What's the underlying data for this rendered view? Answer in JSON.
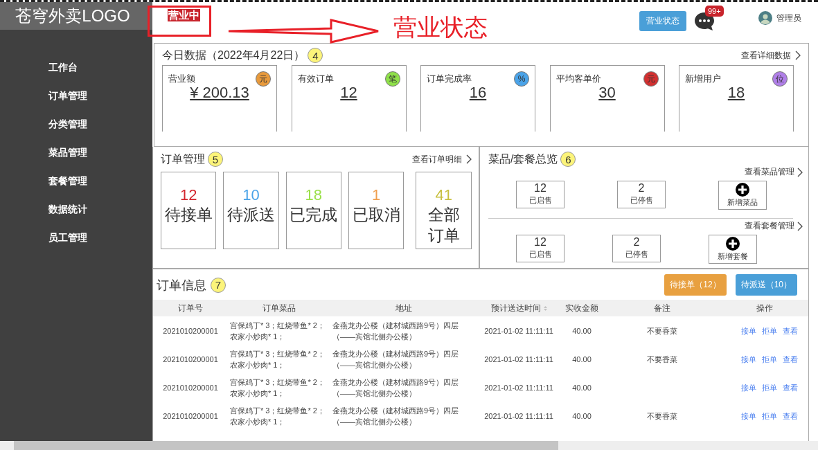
{
  "sidebar": {
    "logo": "苍穹外卖LOGO",
    "items": [
      {
        "label": "工作台"
      },
      {
        "label": "订单管理"
      },
      {
        "label": "分类管理"
      },
      {
        "label": "菜品管理"
      },
      {
        "label": "套餐管理"
      },
      {
        "label": "数据统计"
      },
      {
        "label": "员工管理"
      }
    ]
  },
  "header": {
    "status_badge": "营业中",
    "status_button": "营业状态",
    "message_count": "99+",
    "user": "管理员"
  },
  "annotation": {
    "label": "营业状态"
  },
  "today": {
    "title": "今日数据（2022年4月22日）",
    "marker": "4",
    "link": "查看详细数据",
    "cards": [
      {
        "label": "营业额",
        "value": "¥ 200.13",
        "unit": "元",
        "color": "#e89a3c"
      },
      {
        "label": "有效订单",
        "value": "12",
        "unit": "笔",
        "color": "#8fe04a"
      },
      {
        "label": "订单完成率",
        "value": "16",
        "unit": "%",
        "color": "#4aa3e8"
      },
      {
        "label": "平均客单价",
        "value": "30",
        "unit": "元",
        "color": "#d23030"
      },
      {
        "label": "新增用户",
        "value": "18",
        "unit": "位",
        "color": "#b07fe8"
      }
    ]
  },
  "orders": {
    "title": "订单管理",
    "marker": "5",
    "link": "查看订单明细",
    "tiles": [
      {
        "count": "12",
        "label": "待接单",
        "color": "#d3262e"
      },
      {
        "count": "10",
        "label": "待派送",
        "color": "#4aa3e8"
      },
      {
        "count": "18",
        "label": "已完成",
        "color": "#9be04a"
      },
      {
        "count": "1",
        "label": "已取消",
        "color": "#f0a050"
      },
      {
        "count": "41",
        "label": "全部订单",
        "color": "#c8c040"
      }
    ]
  },
  "overview": {
    "title": "菜品/套餐总览",
    "marker": "6",
    "groups": [
      {
        "link": "查看菜品管理",
        "stats": [
          {
            "count": "12",
            "label": "已启售"
          },
          {
            "count": "2",
            "label": "已停售"
          }
        ],
        "add": "新增菜品"
      },
      {
        "link": "查看套餐管理",
        "stats": [
          {
            "count": "12",
            "label": "已启售"
          },
          {
            "count": "2",
            "label": "已停售"
          }
        ],
        "add": "新增套餐"
      }
    ]
  },
  "order_info": {
    "title": "订单信息",
    "marker": "7",
    "buttons": [
      {
        "label": "待接单（12）",
        "color": "#e8a040"
      },
      {
        "label": "待派送（10）",
        "color": "#4a9fd8"
      }
    ]
  },
  "table": {
    "columns": [
      "订单号",
      "订单菜品",
      "地址",
      "预计送达时间",
      "实收金额",
      "备注",
      "操作"
    ],
    "rows": [
      {
        "order_no": "2021010200001",
        "dishes": "宫保鸡丁* 3；红烧带鱼* 2；农家小炒肉* 1；",
        "address": "金燕龙办公楼（建材城西路9号）四层（——宾馆北侧办公楼）",
        "eta": "2021-01-02 11:11:11",
        "amount": "40.00",
        "note": "不要香菜",
        "actions": [
          "接单",
          "拒单",
          "查看"
        ]
      },
      {
        "order_no": "2021010200001",
        "dishes": "宫保鸡丁* 3；红烧带鱼* 2；农家小炒肉* 1；",
        "address": "金燕龙办公楼（建材城西路9号）四层（——宾馆北侧办公楼）",
        "eta": "2021-01-02 11:11:11",
        "amount": "40.00",
        "note": "不要香菜",
        "actions": [
          "接单",
          "拒单",
          "查看"
        ]
      },
      {
        "order_no": "2021010200001",
        "dishes": "宫保鸡丁* 3；红烧带鱼* 2；农家小炒肉* 1；",
        "address": "金燕龙办公楼（建材城西路9号）四层（——宾馆北侧办公楼）",
        "eta": "2021-01-02 11:11:11",
        "amount": "40.00",
        "actions": [
          "接单",
          "拒单",
          "查看"
        ]
      },
      {
        "order_no": "2021010200001",
        "dishes": "宫保鸡丁* 3；红烧带鱼* 2；农家小炒肉* 1；",
        "address": "金燕龙办公楼（建材城西路9号）四层（——宾馆北侧办公楼）",
        "eta": "2021-01-02 11:11:11",
        "amount": "40.00",
        "note": "不要香菜",
        "actions": [
          "接单",
          "拒单",
          "查看"
        ]
      }
    ]
  }
}
